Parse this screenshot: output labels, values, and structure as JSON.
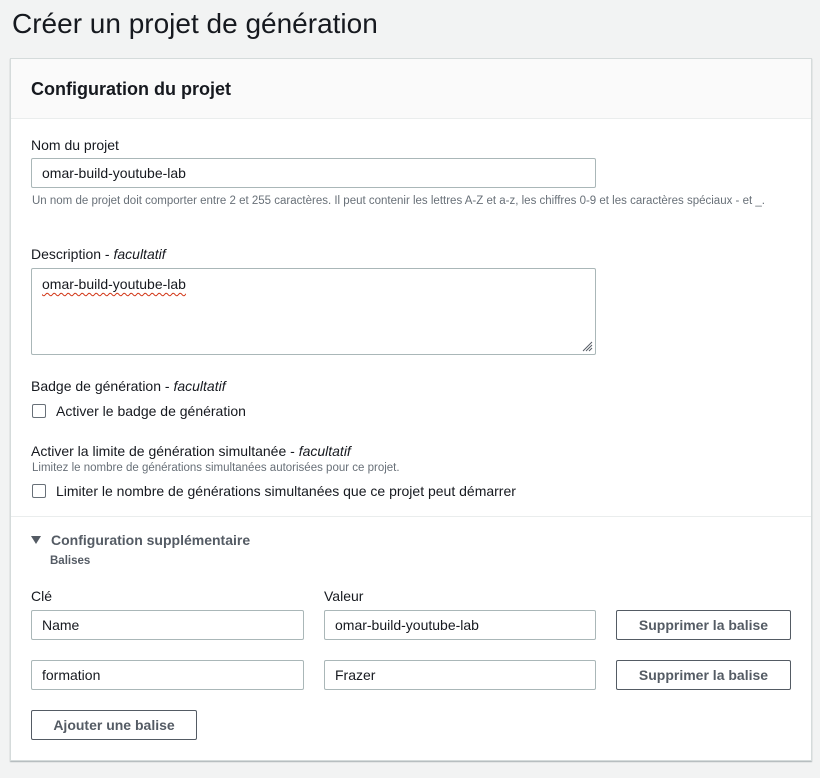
{
  "page": {
    "title": "Créer un projet de génération"
  },
  "config": {
    "heading": "Configuration du projet",
    "project_name": {
      "label": "Nom du projet",
      "value": "omar-build-youtube-lab",
      "hint": "Un nom de projet doit comporter entre 2 et 255 caractères. Il peut contenir les lettres A-Z et a-z, les chiffres 0-9 et les caractères spéciaux - et _."
    },
    "description": {
      "label": "Description -",
      "optional": "facultatif",
      "value": "omar-build-youtube-lab"
    },
    "badge": {
      "label": "Badge de génération -",
      "optional": "facultatif",
      "checkbox_label": "Activer le badge de génération",
      "checked": false
    },
    "concurrency": {
      "label": "Activer la limite de génération simultanée -",
      "optional": "facultatif",
      "hint": "Limitez le nombre de générations simultanées autorisées pour ce projet.",
      "checkbox_label": "Limiter le nombre de générations simultanées que ce projet peut démarrer",
      "checked": false
    }
  },
  "additional": {
    "label": "Configuration supplémentaire",
    "tags_label": "Balises",
    "key_header": "Clé",
    "value_header": "Valeur",
    "tags": [
      {
        "key": "Name",
        "value": "omar-build-youtube-lab",
        "remove_label": "Supprimer la balise"
      },
      {
        "key": "formation",
        "value": "Frazer",
        "remove_label": "Supprimer la balise"
      }
    ],
    "add_label": "Ajouter une balise"
  }
}
